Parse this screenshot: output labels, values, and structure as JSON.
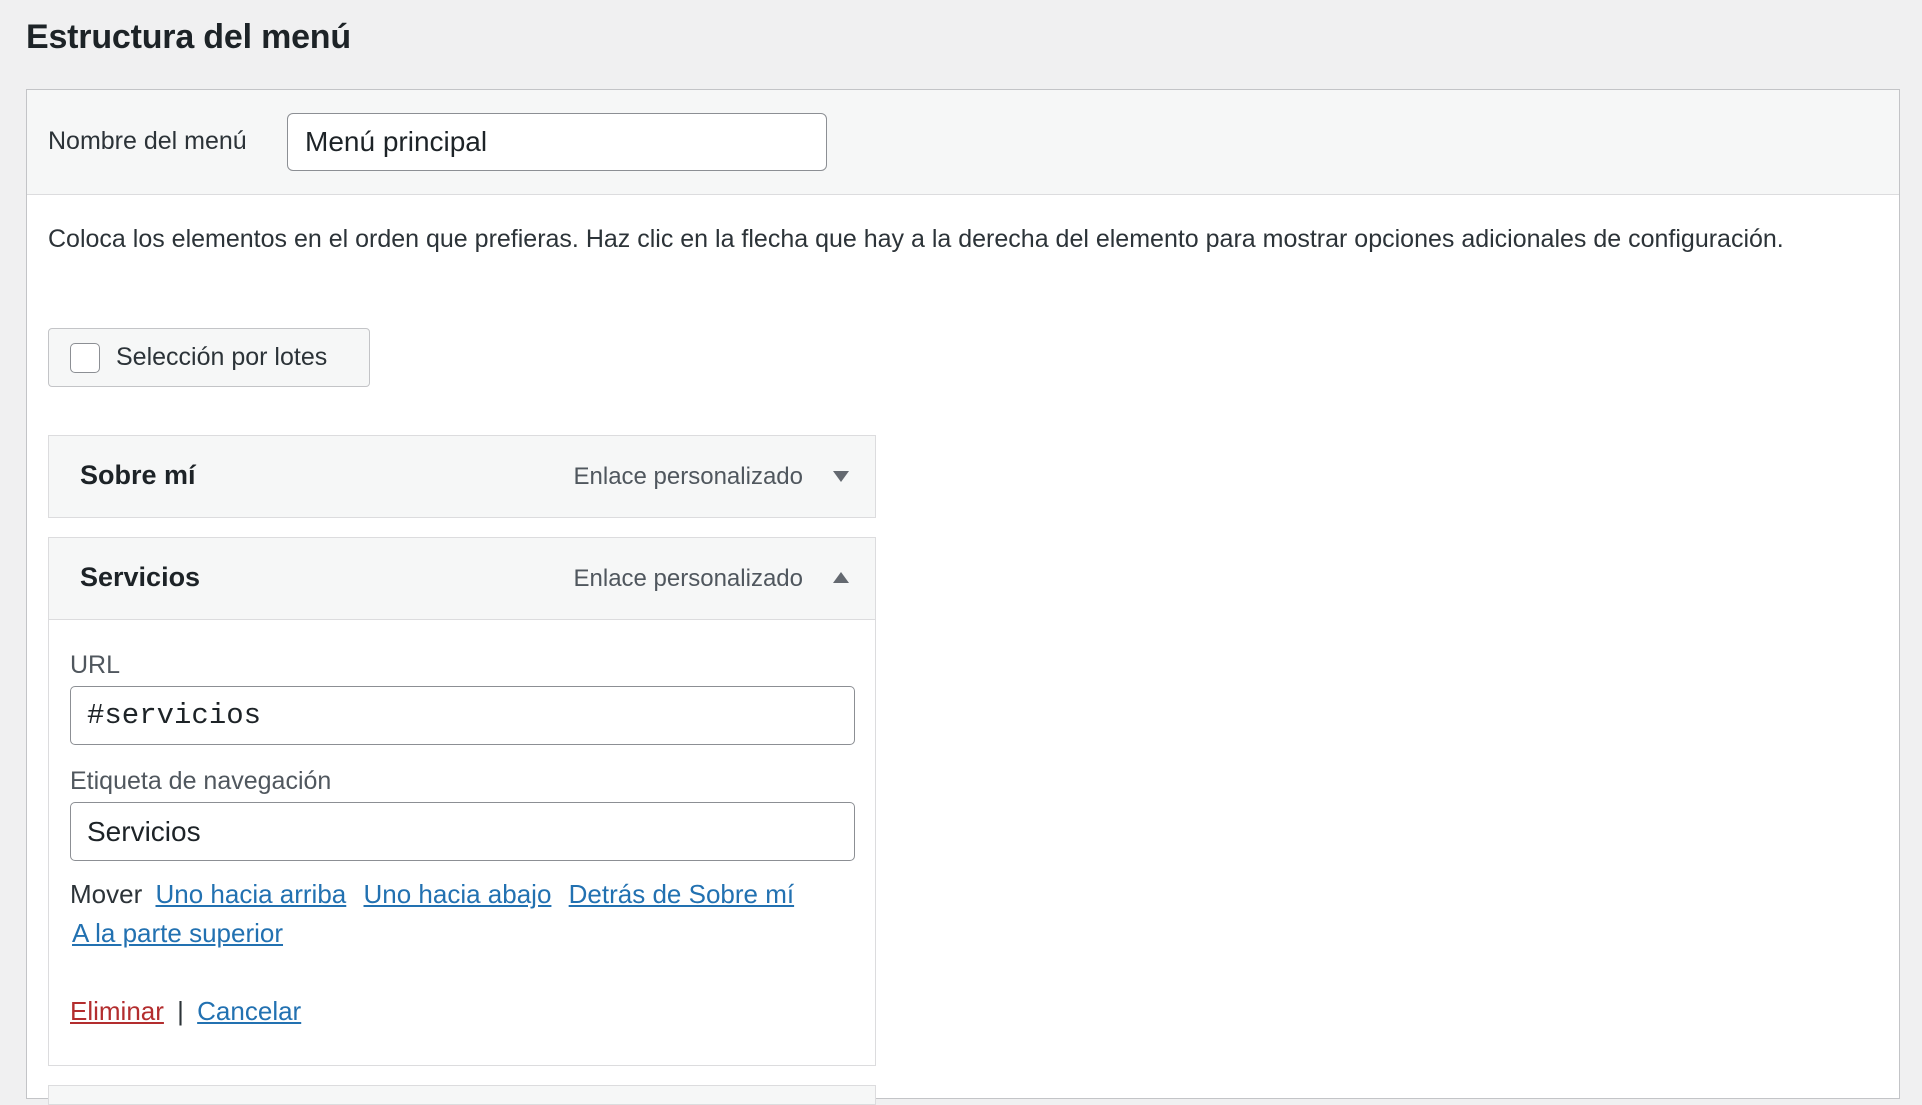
{
  "page": {
    "title": "Estructura del menú"
  },
  "menu_name": {
    "label": "Nombre del menú",
    "value": "Menú principal"
  },
  "instructions": "Coloca los elementos en el orden que prefieras. Haz clic en la flecha que hay a la derecha del elemento para mostrar opciones adicionales de configuración.",
  "bulk_select": {
    "label": "Selección por lotes",
    "checked": false
  },
  "items": [
    {
      "title": "Sobre mí",
      "type": "Enlace personalizado",
      "expanded": false,
      "arrow_icon": "triangle-down-icon"
    },
    {
      "title": "Servicios",
      "type": "Enlace personalizado",
      "expanded": true,
      "arrow_icon": "triangle-up-icon",
      "settings": {
        "url_label": "URL",
        "url_value": "#servicios",
        "nav_label_label": "Etiqueta de navegación",
        "nav_label_value": "Servicios",
        "move_label": "Mover",
        "move_links": [
          "Uno hacia arriba",
          "Uno hacia abajo",
          "Detrás de Sobre mí",
          "A la parte superior"
        ],
        "delete_label": "Eliminar",
        "separator": "|",
        "cancel_label": "Cancelar"
      }
    }
  ],
  "colors": {
    "link": "#2271b1",
    "delete": "#b32d2e",
    "background": "#f0f0f1",
    "panel": "#f6f7f7"
  }
}
